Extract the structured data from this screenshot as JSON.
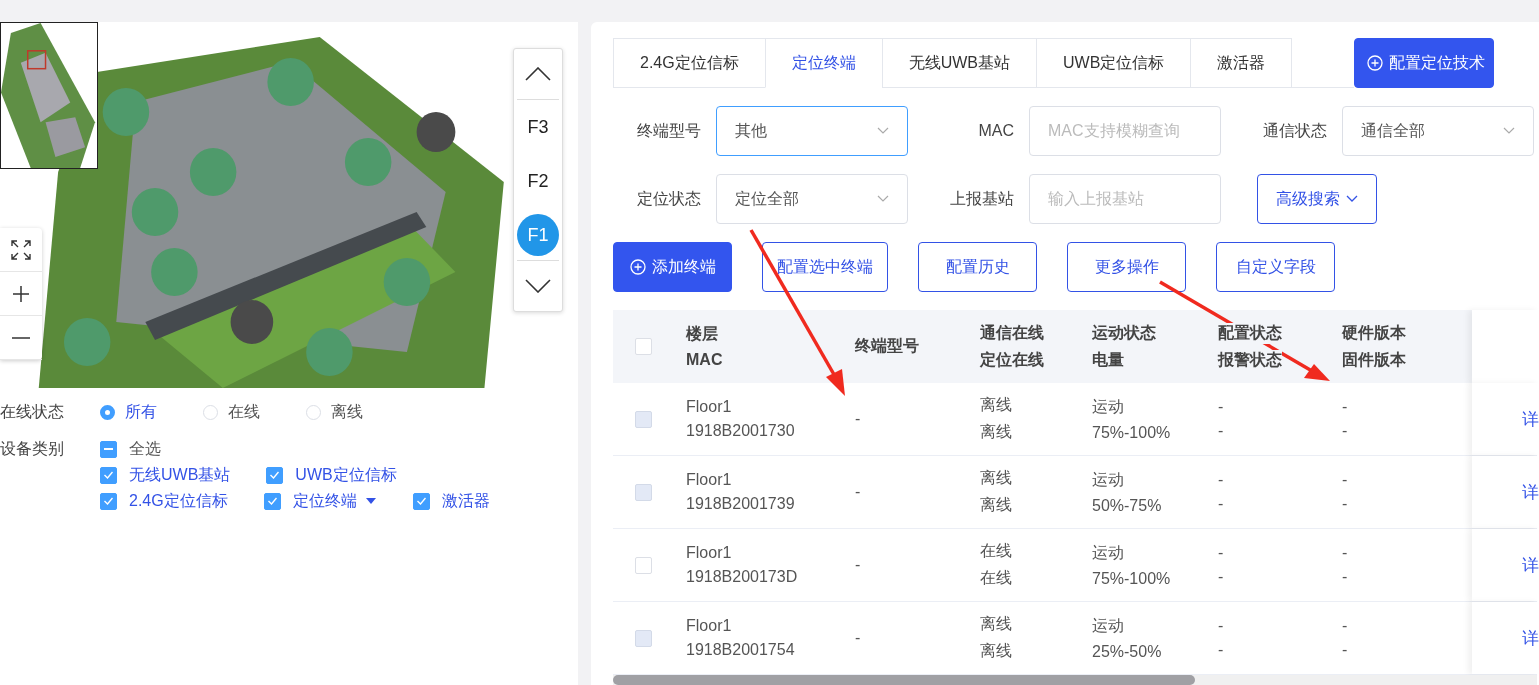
{
  "map": {
    "floors": [
      {
        "label": "F3",
        "selected": false
      },
      {
        "label": "F2",
        "selected": false
      },
      {
        "label": "F1",
        "selected": true
      }
    ]
  },
  "online_status": {
    "label": "在线状态",
    "options": [
      {
        "label": "所有",
        "selected": true
      },
      {
        "label": "在线",
        "selected": false
      },
      {
        "label": "离线",
        "selected": false
      }
    ]
  },
  "device_category": {
    "label": "设备类别",
    "select_all": {
      "label": "全选",
      "indeterminate": true
    },
    "rows": [
      [
        {
          "label": "无线UWB基站",
          "checked": true,
          "dropdown": false
        },
        {
          "label": "UWB定位信标",
          "checked": true,
          "dropdown": false
        }
      ],
      [
        {
          "label": "2.4G定位信标",
          "checked": true,
          "dropdown": false
        },
        {
          "label": "定位终端",
          "checked": true,
          "dropdown": true
        },
        {
          "label": "激活器",
          "checked": true,
          "dropdown": false
        }
      ]
    ]
  },
  "tabs": [
    {
      "label": "2.4G定位信标",
      "selected": false
    },
    {
      "label": "定位终端",
      "selected": true
    },
    {
      "label": "无线UWB基站",
      "selected": false
    },
    {
      "label": "UWB定位信标",
      "selected": false
    },
    {
      "label": "激活器",
      "selected": false
    }
  ],
  "config_button": "配置定位技术",
  "filters": [
    [
      {
        "label": "终端型号",
        "kind": "select",
        "value": "其他",
        "focused": true
      },
      {
        "label": "MAC",
        "kind": "input",
        "placeholder": "MAC支持模糊查询"
      },
      {
        "label": "通信状态",
        "kind": "select",
        "value": "通信全部",
        "focused": false
      }
    ],
    [
      {
        "label": "定位状态",
        "kind": "select",
        "value": "定位全部",
        "focused": false
      },
      {
        "label": "上报基站",
        "kind": "input",
        "placeholder": "输入上报基站"
      },
      {
        "label": "高级搜索",
        "kind": "button"
      }
    ]
  ],
  "actions": [
    {
      "label": "添加终端",
      "kind": "primary"
    },
    {
      "label": "配置选中终端",
      "kind": "outline"
    },
    {
      "label": "配置历史",
      "kind": "outline"
    },
    {
      "label": "更多操作",
      "kind": "outline"
    },
    {
      "label": "自定义字段",
      "kind": "outline"
    }
  ],
  "table": {
    "all_checked": false,
    "columns": [
      {
        "title": "楼层",
        "subtitle": "MAC"
      },
      {
        "title": "终端型号"
      },
      {
        "title": "通信在线",
        "subtitle": "定位在线"
      },
      {
        "title": "运动状态",
        "subtitle": "电量"
      },
      {
        "title": "配置状态",
        "subtitle": "报警状态"
      },
      {
        "title": "硬件版本",
        "subtitle": "固件版本"
      }
    ],
    "rows": [
      {
        "disabled": true,
        "cells": [
          [
            "Floor1",
            "1918B2001730"
          ],
          [
            "-"
          ],
          [
            "离线",
            "离线"
          ],
          [
            "运动",
            "75%-100%"
          ],
          [
            "-",
            "-"
          ],
          [
            "-",
            "-"
          ]
        ],
        "action": "详"
      },
      {
        "disabled": true,
        "cells": [
          [
            "Floor1",
            "1918B2001739"
          ],
          [
            "-"
          ],
          [
            "离线",
            "离线"
          ],
          [
            "运动",
            "50%-75%"
          ],
          [
            "-",
            "-"
          ],
          [
            "-",
            "-"
          ]
        ],
        "action": "详"
      },
      {
        "disabled": false,
        "cells": [
          [
            "Floor1",
            "1918B200173D"
          ],
          [
            "-"
          ],
          [
            "在线",
            "在线"
          ],
          [
            "运动",
            "75%-100%"
          ],
          [
            "-",
            "-"
          ],
          [
            "-",
            "-"
          ]
        ],
        "action": "详"
      },
      {
        "disabled": true,
        "cells": [
          [
            "Floor1",
            "1918B2001754"
          ],
          [
            "-"
          ],
          [
            "离线",
            "离线"
          ],
          [
            "运动",
            "25%-50%"
          ],
          [
            "-",
            "-"
          ],
          [
            "-",
            "-"
          ]
        ],
        "action": "详"
      }
    ]
  }
}
